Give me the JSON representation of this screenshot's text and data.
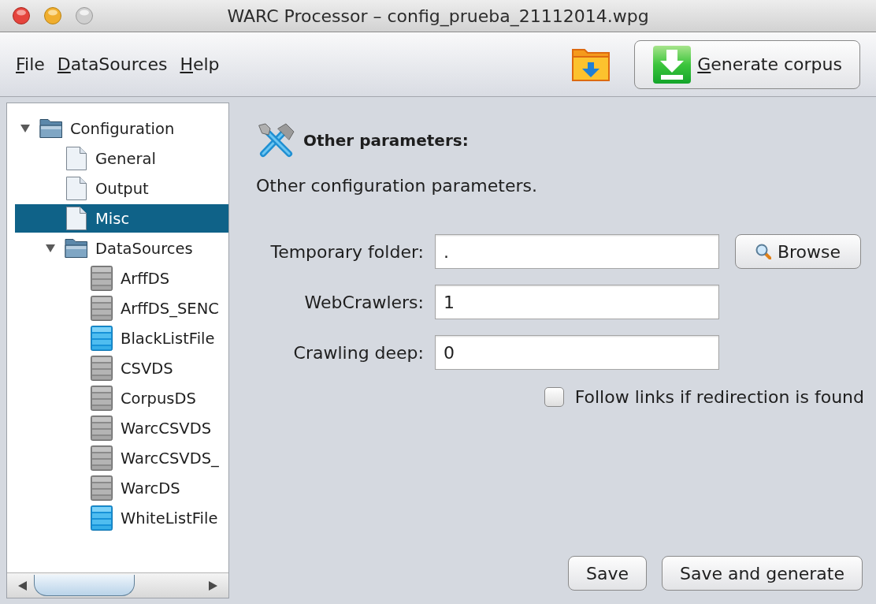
{
  "window": {
    "title": "WARC Processor – config_prueba_21112014.wpg"
  },
  "menu": [
    {
      "label": "File"
    },
    {
      "label": "DataSources"
    },
    {
      "label": "Help"
    }
  ],
  "toolbar": {
    "generate_button": "Generate corpus"
  },
  "tree": [
    {
      "label": "Configuration",
      "kind": "folder",
      "expanded": true,
      "selected": false,
      "children": [
        {
          "label": "General",
          "kind": "page",
          "selected": false
        },
        {
          "label": "Output",
          "kind": "page",
          "selected": false
        },
        {
          "label": "Misc",
          "kind": "page",
          "selected": true
        },
        {
          "label": "DataSources",
          "kind": "folder",
          "expanded": true,
          "selected": false,
          "children": [
            {
              "label": "ArffDS",
              "kind": "database",
              "selected": false
            },
            {
              "label": "ArffDS_SENC",
              "kind": "database",
              "selected": false
            },
            {
              "label": "BlackListFile",
              "kind": "listfile",
              "selected": false
            },
            {
              "label": "CSVDS",
              "kind": "database",
              "selected": false
            },
            {
              "label": "CorpusDS",
              "kind": "database",
              "selected": false
            },
            {
              "label": "WarcCSVDS",
              "kind": "database",
              "selected": false
            },
            {
              "label": "WarcCSVDS_",
              "kind": "database",
              "selected": false
            },
            {
              "label": "WarcDS",
              "kind": "database",
              "selected": false
            },
            {
              "label": "WhiteListFile",
              "kind": "listfile",
              "selected": false
            }
          ]
        }
      ]
    }
  ],
  "panel": {
    "title": "Other parameters:",
    "description": "Other configuration parameters.",
    "fields": [
      {
        "label": "Temporary folder:",
        "value": ".",
        "button": "Browse"
      },
      {
        "label": "WebCrawlers:",
        "value": "1"
      },
      {
        "label": "Crawling deep:",
        "value": "0"
      }
    ],
    "checkbox": {
      "label": "Follow links if redirection is found",
      "checked": false
    }
  },
  "buttons": [
    {
      "label": "Save"
    },
    {
      "label": "Save and generate"
    }
  ]
}
